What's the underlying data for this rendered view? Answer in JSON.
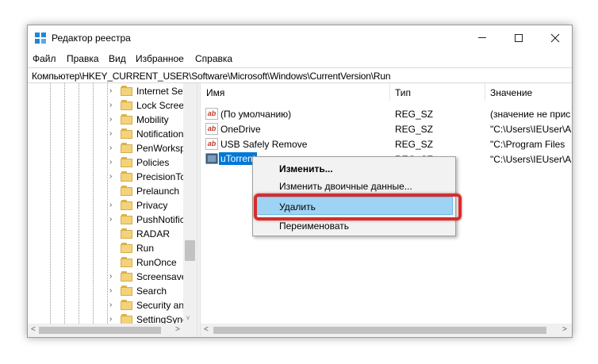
{
  "window": {
    "title": "Редактор реестра"
  },
  "menu": [
    "Файл",
    "Правка",
    "Вид",
    "Избранное",
    "Справка"
  ],
  "address": "Компьютер\\HKEY_CURRENT_USER\\Software\\Microsoft\\Windows\\CurrentVersion\\Run",
  "tree": {
    "items": [
      {
        "label": "Internet Set",
        "expander": "›"
      },
      {
        "label": "Lock Screer",
        "expander": "›"
      },
      {
        "label": "Mobility",
        "expander": "›"
      },
      {
        "label": "Notification",
        "expander": "›"
      },
      {
        "label": "PenWorksp",
        "expander": "›"
      },
      {
        "label": "Policies",
        "expander": "›"
      },
      {
        "label": "PrecisionTc",
        "expander": "›"
      },
      {
        "label": "Prelaunch",
        "expander": ""
      },
      {
        "label": "Privacy",
        "expander": "›"
      },
      {
        "label": "PushNotific",
        "expander": "›"
      },
      {
        "label": "RADAR",
        "expander": ""
      },
      {
        "label": "Run",
        "expander": ""
      },
      {
        "label": "RunOnce",
        "expander": ""
      },
      {
        "label": "Screensave",
        "expander": "›"
      },
      {
        "label": "Search",
        "expander": "›"
      },
      {
        "label": "Security an",
        "expander": "›"
      },
      {
        "label": "SettingSync",
        "expander": "›"
      }
    ],
    "selected": "Run"
  },
  "list": {
    "columns": {
      "name": "Имя",
      "type": "Тип",
      "value": "Значение"
    },
    "rows": [
      {
        "name": "(По умолчанию)",
        "type": "REG_SZ",
        "value": "(значение не прис",
        "icon": "ab"
      },
      {
        "name": "OneDrive",
        "type": "REG_SZ",
        "value": "\"C:\\Users\\IEUser\\A",
        "icon": "ab"
      },
      {
        "name": "USB Safely Remove",
        "type": "REG_SZ",
        "value": "\"C:\\Program Files",
        "icon": "ab"
      },
      {
        "name": "uTorrent",
        "type": "REG_SZ",
        "value": "\"C:\\Users\\IEUser\\A",
        "icon": "utorrent"
      }
    ]
  },
  "context_menu": {
    "items": [
      "Изменить...",
      "Изменить двоичные данные...",
      "Удалить",
      "Переименовать"
    ],
    "highlighted": "Удалить",
    "highlight_color": "#9fd3f4",
    "outline_color": "#d62c2c"
  },
  "scroll_arrows": {
    "left": "<",
    "right": ">",
    "down": "v"
  }
}
